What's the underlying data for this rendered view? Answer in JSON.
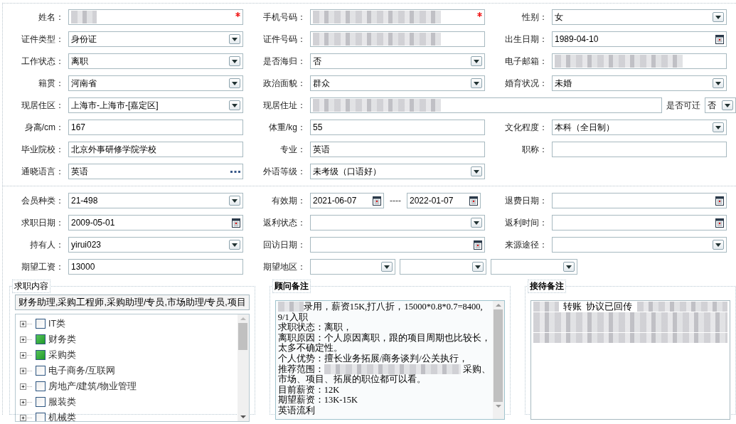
{
  "personal_info": {
    "rows": [
      [
        {
          "label": "姓名：",
          "kind": "text",
          "redacted": true,
          "required": true
        },
        {
          "label": "手机号码：",
          "kind": "text",
          "redacted": true,
          "required": true
        },
        {
          "label": "性别：",
          "kind": "select",
          "value": "女",
          "required": false
        }
      ],
      [
        {
          "label": "证件类型：",
          "kind": "select",
          "value": "身份证",
          "required": false
        },
        {
          "label": "证件号码：",
          "kind": "text",
          "redacted": true,
          "required": false
        },
        {
          "label": "出生日期：",
          "kind": "date",
          "value": "1989-04-10",
          "required": false
        }
      ],
      [
        {
          "label": "工作状态：",
          "kind": "select",
          "value": "离职",
          "required": false
        },
        {
          "label": "是否海归：",
          "kind": "select",
          "value": "否",
          "required": false
        },
        {
          "label": "电子邮箱：",
          "kind": "text",
          "redacted": true,
          "required": false
        }
      ],
      [
        {
          "label": "籍贯：",
          "kind": "select",
          "value": "河南省",
          "required": false
        },
        {
          "label": "政治面貌：",
          "kind": "select",
          "value": "群众",
          "required": false
        },
        {
          "label": "婚育状况：",
          "kind": "select",
          "value": "未婚",
          "required": false
        }
      ],
      [
        {
          "label": "现居住区：",
          "kind": "select",
          "value": "上海市-上海市-[嘉定区]",
          "required": false
        },
        {
          "label": "现居住址：",
          "kind": "wide_text",
          "redacted": true,
          "required": false
        },
        {
          "label": "是否可迁",
          "kind": "small_select",
          "value": "否",
          "required": false
        }
      ],
      [
        {
          "label": "身高/cm：",
          "kind": "text",
          "value": "167",
          "required": false
        },
        {
          "label": "体重/kg：",
          "kind": "text",
          "value": "55",
          "required": false
        },
        {
          "label": "文化程度：",
          "kind": "select",
          "value": "本科（全日制）",
          "required": false
        }
      ],
      [
        {
          "label": "毕业院校：",
          "kind": "text",
          "value": "北京外事研修学院学校",
          "required": false
        },
        {
          "label": "专业：",
          "kind": "text",
          "value": "英语",
          "required": false
        },
        {
          "label": "职称：",
          "kind": "text",
          "required": false
        }
      ],
      [
        {
          "label": "通晓语言：",
          "kind": "lookup",
          "value": "英语",
          "required": false
        },
        {
          "label": "外语等级：",
          "kind": "select",
          "value": "未考级（口语好）",
          "required": false
        }
      ]
    ]
  },
  "membership": {
    "rows": [
      [
        {
          "label": "会员种类：",
          "kind": "select",
          "value": "21-498",
          "required": false
        },
        {
          "label": "有效期：",
          "kind": "date_range",
          "values": [
            "2021-06-07",
            "2022-01-07"
          ],
          "separator": "----",
          "required": false
        },
        {
          "label": "退费日期：",
          "kind": "date",
          "required": false
        }
      ],
      [
        {
          "label": "求职日期：",
          "kind": "date",
          "value": "2009-05-01",
          "required": false
        },
        {
          "label": "返利状态：",
          "kind": "select",
          "required": false
        },
        {
          "label": "返利时间：",
          "kind": "date",
          "required": false
        }
      ],
      [
        {
          "label": "持有人：",
          "kind": "select",
          "value": "yirui023",
          "required": false
        },
        {
          "label": "回访日期：",
          "kind": "date",
          "required": false
        },
        {
          "label": "来源途径：",
          "kind": "select",
          "required": false
        }
      ],
      [
        {
          "label": "期望工资：",
          "kind": "text",
          "value": "13000",
          "required": false
        },
        {
          "label": "期望地区：",
          "kind": "multi_select",
          "selects": [
            {
              "kind": "select"
            },
            {
              "kind": "select"
            },
            {
              "kind": "select"
            }
          ],
          "required": false
        }
      ]
    ]
  },
  "job_intent": {
    "legend": "求职内容",
    "summary": "财务助理,采购工程师,采购助理/专员,市场助理/专员,项目",
    "categories": [
      {
        "label": "IT类",
        "checked": false,
        "expanded": false
      },
      {
        "label": "财务类",
        "checked": true,
        "expanded": false
      },
      {
        "label": "采购类",
        "checked": true,
        "expanded": false
      },
      {
        "label": "电子商务/互联网",
        "checked": false,
        "expanded": false
      },
      {
        "label": "房地产/建筑/物业管理",
        "checked": false,
        "expanded": false
      },
      {
        "label": "服装类",
        "checked": false,
        "expanded": false
      },
      {
        "label": "机械类",
        "checked": false,
        "expanded": false
      }
    ]
  },
  "consultant_notes": {
    "legend": "顾问备注",
    "lines": [
      [
        {
          "kind": "redacted"
        },
        {
          "kind": "text",
          "text": "录用，薪资15K,打八折，15000*0.8*0.7=8400,"
        }
      ],
      [
        {
          "kind": "text",
          "text": "9/1入职"
        }
      ],
      [
        {
          "kind": "text",
          "text": "求职状态：离职，"
        }
      ],
      [
        {
          "kind": "text",
          "text": "离职原因：个人原因离职，跟的项目周期也比较长，"
        }
      ],
      [
        {
          "kind": "text",
          "text": "太多不确定性。"
        }
      ],
      [
        {
          "kind": "text",
          "text": "个人优势：擅长业务拓展/商务谈判/公关执行，"
        }
      ],
      [
        {
          "kind": "text",
          "text": "推荐范围："
        },
        {
          "kind": "redacted"
        },
        {
          "kind": "text",
          "text": " 采购、"
        }
      ],
      [
        {
          "kind": "text",
          "text": "市场、项目、拓展的职位都可以看。"
        }
      ],
      [
        {
          "kind": "text",
          "text": "目前薪资：12K"
        }
      ],
      [
        {
          "kind": "text",
          "text": "期望薪资：13K-15K"
        }
      ],
      [
        {
          "kind": "text",
          "text": "英语流利"
        }
      ]
    ]
  },
  "reception_notes": {
    "legend": "接待备注",
    "lines": [
      [
        {
          "kind": "redacted"
        },
        {
          "kind": "text",
          "text": "  转账  协议已回传  "
        },
        {
          "kind": "redacted"
        }
      ],
      [
        {
          "kind": "redacted"
        }
      ],
      [
        {
          "kind": "redacted"
        }
      ],
      [
        {
          "kind": "redacted"
        }
      ]
    ]
  }
}
